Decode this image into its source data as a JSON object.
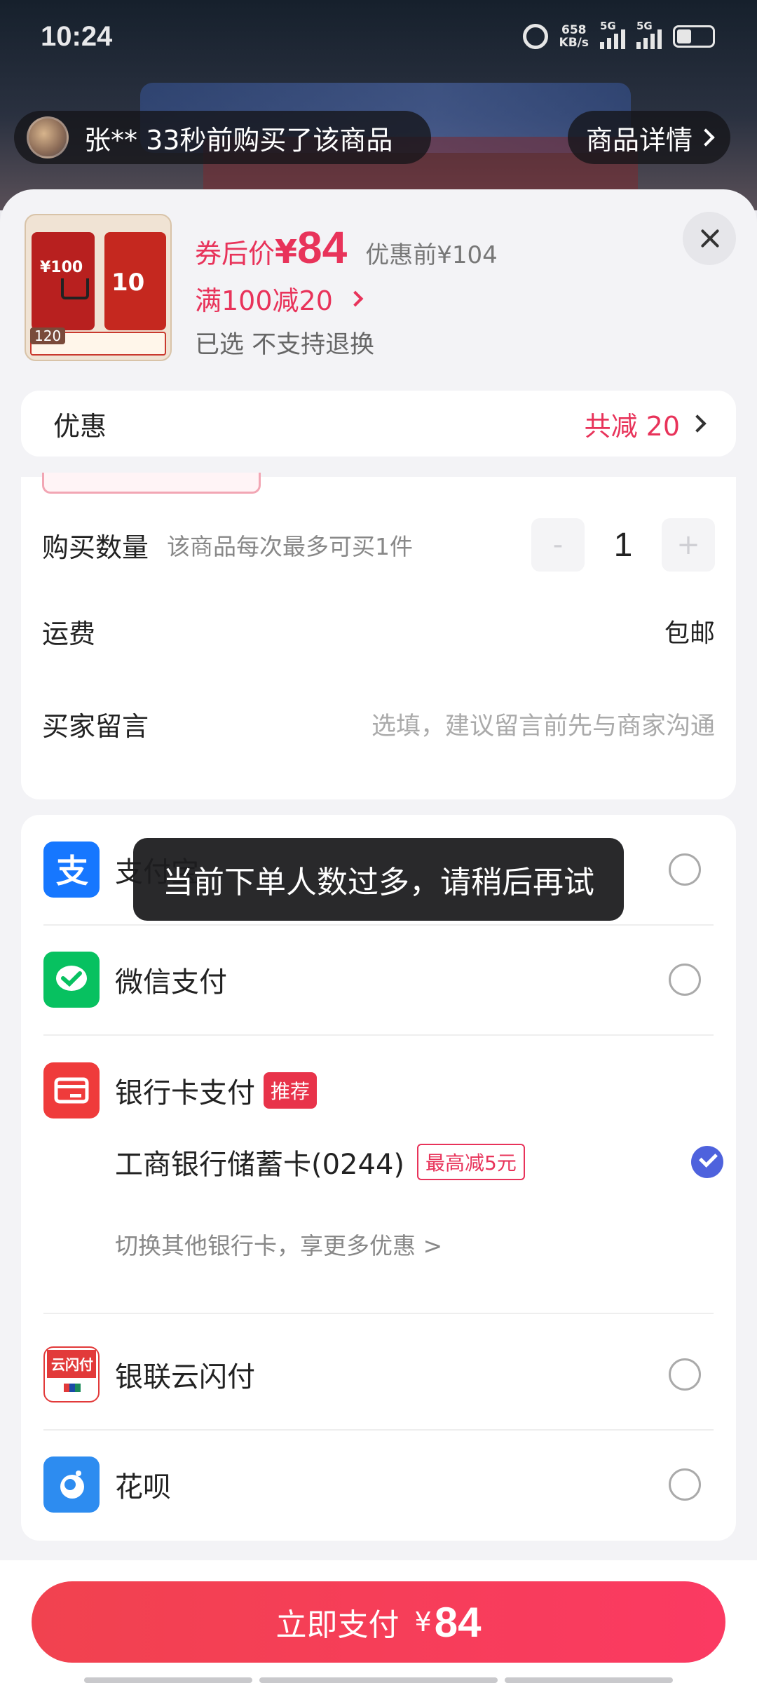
{
  "status_bar": {
    "time": "10:24",
    "speed": "658\nKB/s",
    "net1": "5G",
    "net2": "5G"
  },
  "notice": {
    "text": "张** 33秒前购买了该商品",
    "detail_button": "商品详情"
  },
  "product": {
    "thumb_tag": "120",
    "thumb_card1": "¥100",
    "thumb_card2": "10",
    "price_label": "券后价",
    "currency": "¥",
    "price": "84",
    "original_price": "优惠前¥104",
    "promo": "满100减20",
    "selected": "已选  不支持退换"
  },
  "discount": {
    "label": "优惠",
    "value": "共减 20"
  },
  "order": {
    "quantity_label": "购买数量",
    "quantity_note": "该商品每次最多可买1件",
    "quantity_minus": "-",
    "quantity": "1",
    "quantity_plus": "+",
    "shipping_label": "运费",
    "shipping_value": "包邮",
    "message_label": "买家留言",
    "message_placeholder": "选填，建议留言前先与商家沟通"
  },
  "payments": {
    "alipay": "支付宝",
    "wechat": "微信支付",
    "bank": "银行卡支付",
    "recommend": "推荐",
    "bank_card": "工商银行储蓄卡(0244)",
    "bank_offer": "最高减5元",
    "switch_card": "切换其他银行卡，享更多优惠 >",
    "unionpay": "银联云闪付",
    "huabei": "花呗"
  },
  "toast": "当前下单人数过多，请稍后再试",
  "footer": {
    "pay_label": "立即支付",
    "currency": "¥",
    "amount": "84"
  },
  "colors": {
    "accent": "#e8335a",
    "pay_button": "#f5405a",
    "radio_selected": "#4e62dd",
    "alipay": "#1677ff",
    "wechat": "#07c160",
    "bank": "#ef3b3b"
  }
}
